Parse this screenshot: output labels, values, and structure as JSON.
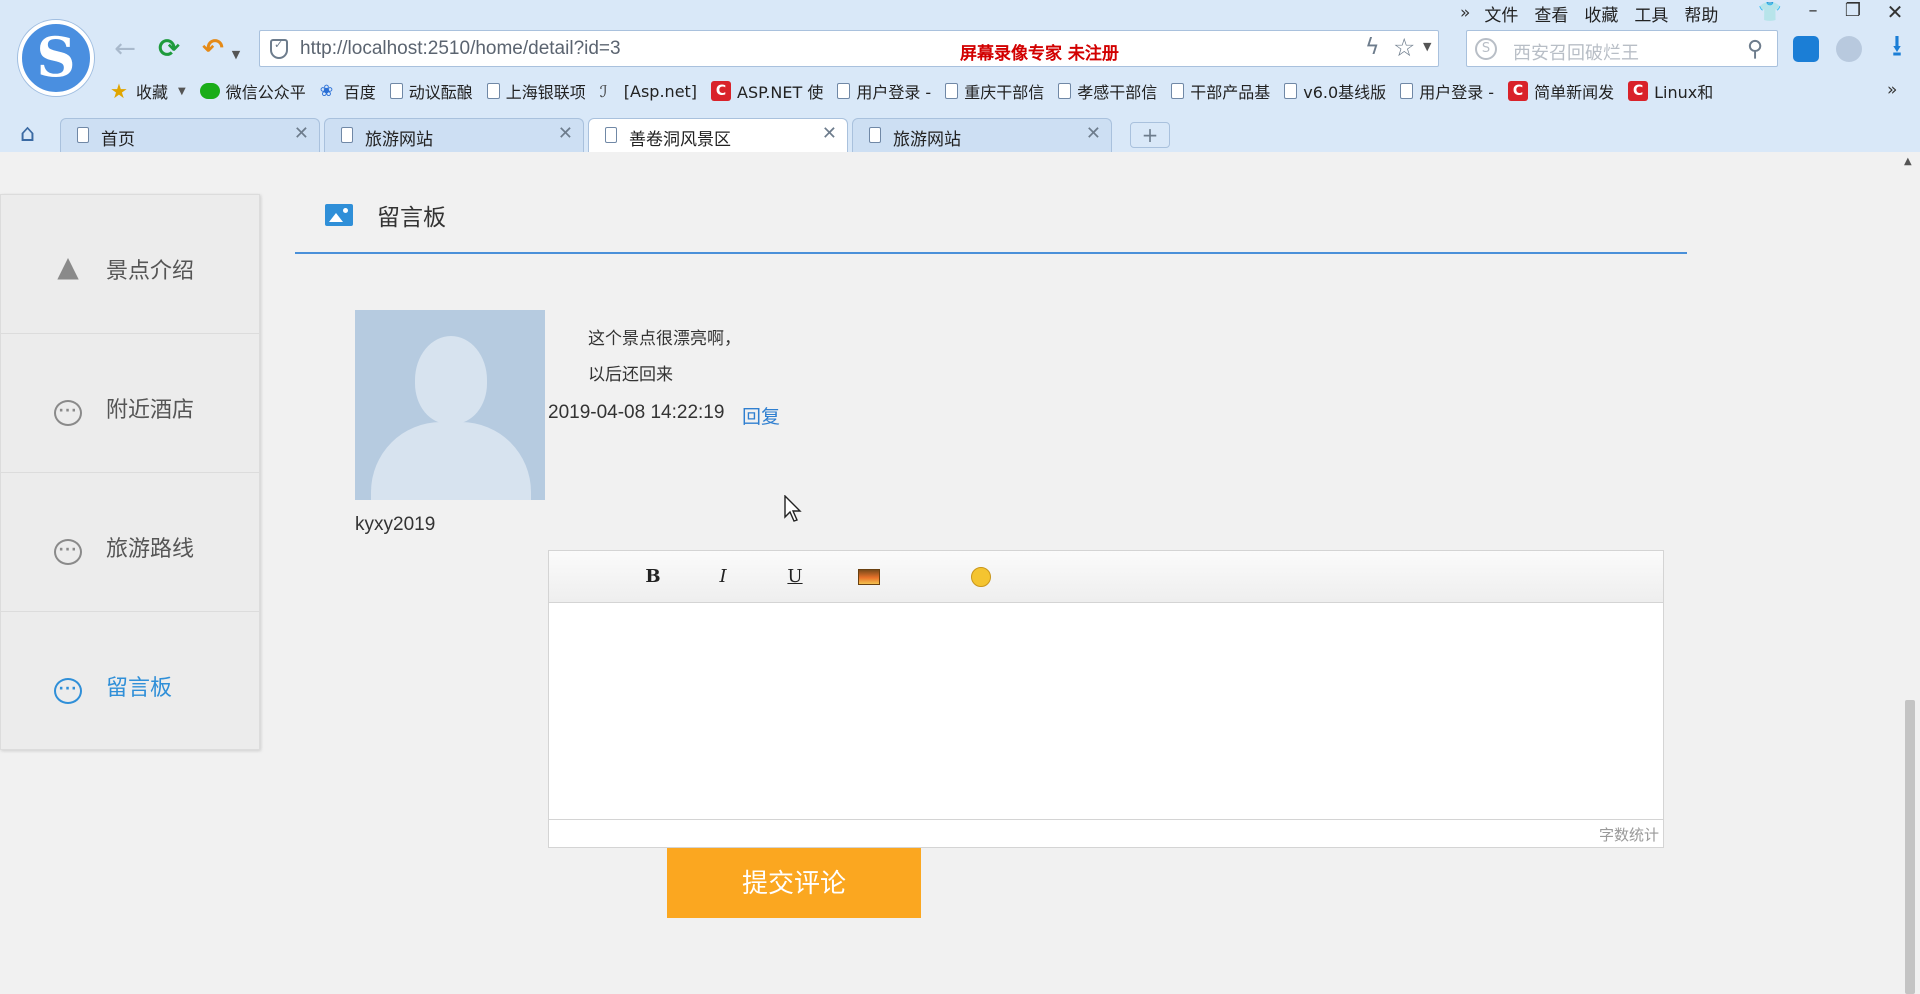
{
  "browser": {
    "address": "http://localhost:2510/home/detail?id=3",
    "watermark": "屏幕录像专家  未注册",
    "search_placeholder": "西安召回破烂王",
    "menu": [
      "文件",
      "查看",
      "收藏",
      "工具",
      "帮助"
    ],
    "menu_more": "»",
    "bookmarks_more": "»",
    "bookmarks": [
      {
        "label": "收藏",
        "icon": "star-icon"
      },
      {
        "label": "微信公众平",
        "icon": "wechat-icon"
      },
      {
        "label": "百度",
        "icon": "baidu-icon"
      },
      {
        "label": "动议酝酿",
        "icon": "page-icon"
      },
      {
        "label": "上海银联项",
        "icon": "page-icon"
      },
      {
        "label": "[Asp.net]",
        "icon": "link-icon"
      },
      {
        "label": "ASP.NET 使",
        "icon": "csdn-icon"
      },
      {
        "label": "用户登录 -",
        "icon": "page-icon"
      },
      {
        "label": "重庆干部信",
        "icon": "page-icon"
      },
      {
        "label": "孝感干部信",
        "icon": "page-icon"
      },
      {
        "label": "干部产品基",
        "icon": "page-icon"
      },
      {
        "label": "v6.0基线版",
        "icon": "page-icon"
      },
      {
        "label": "用户登录 -",
        "icon": "page-icon"
      },
      {
        "label": "简单新闻发",
        "icon": "csdn-icon"
      },
      {
        "label": "Linux和",
        "icon": "csdn-icon"
      }
    ],
    "tabs": [
      {
        "label": "首页"
      },
      {
        "label": "旅游网站"
      },
      {
        "label": "善卷洞风景区"
      },
      {
        "label": "旅游网站"
      }
    ],
    "new_tab": "+",
    "colors": {
      "chrome": "#d9e8f8",
      "accent": "#2f8fd8",
      "submit": "#fba720"
    }
  },
  "sidebar": {
    "items": [
      {
        "label": "景点介绍",
        "icon": "mountain-icon"
      },
      {
        "label": "附近酒店",
        "icon": "chat-bubble-icon"
      },
      {
        "label": "旅游路线",
        "icon": "chat-bubble-icon"
      },
      {
        "label": "留言板",
        "icon": "chat-bubble-icon",
        "active": true
      }
    ]
  },
  "message_board": {
    "title": "留言板",
    "comment": {
      "user": "kyxy2019",
      "line1": "这个景点很漂亮啊，",
      "line2": "以后还回来",
      "time": "2019-04-08 14:22:19",
      "reply": "回复"
    },
    "editor": {
      "bold": "B",
      "italic": "I",
      "underline": "U",
      "word_count": "字数统计"
    },
    "submit": "提交评论"
  }
}
